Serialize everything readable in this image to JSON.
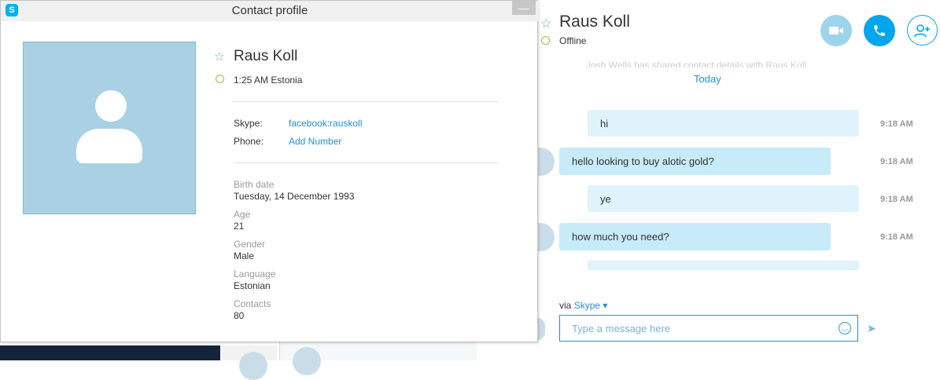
{
  "chat": {
    "name": "Raus Koll",
    "status": "Offline",
    "faded_text": "Josh Wells has shared contact details with Raus Koll.",
    "today": "Today",
    "messages": [
      {
        "text": "hi",
        "time": "9:18 AM",
        "mine": true
      },
      {
        "text": "hello looking to buy alotic gold?",
        "time": "9:18 AM",
        "mine": false
      },
      {
        "text": "ye",
        "time": "9:18 AM",
        "mine": true
      },
      {
        "text": "how much you need?",
        "time": "9:18 AM",
        "mine": false
      }
    ],
    "via_prefix": "via ",
    "via_link": "Skype",
    "input_placeholder": "Type a message here",
    "icons": {
      "video": "video-camera-icon",
      "call": "phone-icon",
      "add": "add-contact-icon",
      "emoji": "smiley-icon",
      "send": "send-icon",
      "star": "star-icon"
    },
    "colors": {
      "accent": "#00a5ec",
      "bubble": "#c7ebf8",
      "online": "#8ec63f"
    }
  },
  "dialog": {
    "title": "Contact profile",
    "close": "—",
    "name": "Raus Koll",
    "local_time": "1:25 AM Estonia",
    "skype_label": "Skype:",
    "skype_value": "facebook:rauskoll",
    "phone_label": "Phone:",
    "phone_value": "Add Number",
    "fields": [
      {
        "label": "Birth date",
        "value": "Tuesday, 14 December 1993"
      },
      {
        "label": "Age",
        "value": "21"
      },
      {
        "label": "Gender",
        "value": "Male"
      },
      {
        "label": "Language",
        "value": "Estonian"
      },
      {
        "label": "Contacts",
        "value": "80"
      }
    ]
  }
}
